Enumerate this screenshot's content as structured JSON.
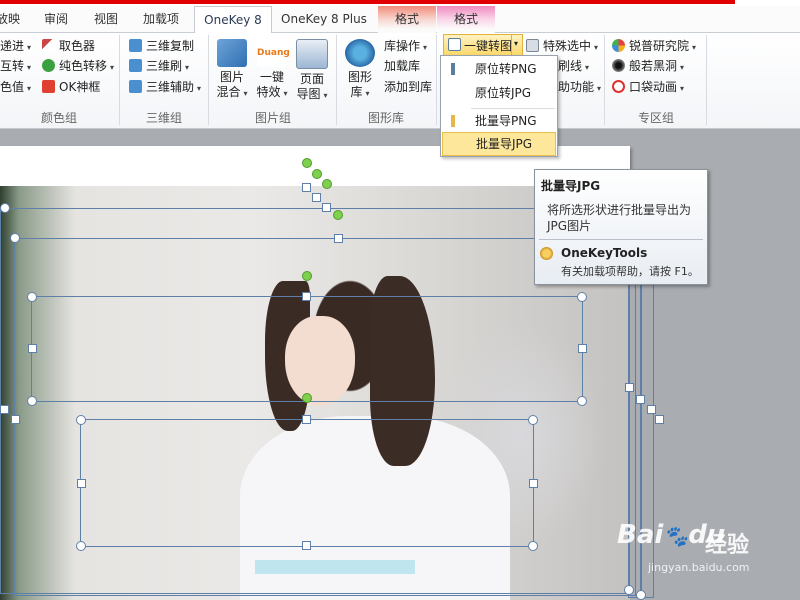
{
  "tabs": [
    "放映",
    "审阅",
    "视图",
    "加载项",
    "OneKey 8",
    "OneKey 8 Plus",
    "格式",
    "格式"
  ],
  "ribbon": {
    "color_group": {
      "items": [
        "递进",
        "取色器",
        "互转",
        "纯色转移",
        "色值",
        "OK神框"
      ],
      "label": "颜色组"
    },
    "threed_group": {
      "items": [
        "三维复制",
        "三维刷",
        "三维辅助"
      ],
      "label": "三维组"
    },
    "image_group": {
      "mix": [
        "图片",
        "混合"
      ],
      "effect": [
        "一键",
        "特效"
      ],
      "page": [
        "页面",
        "导图"
      ],
      "duang": "Duang",
      "label": "图片组"
    },
    "shape_group": {
      "lib": [
        "图形",
        "库"
      ],
      "items": [
        "库操作",
        "加载库",
        "添加到库"
      ],
      "label": "图形库"
    },
    "convert": {
      "split_label": "一键转图",
      "special": "特殊选中",
      "line": "刷线",
      "func": "助功能"
    },
    "zone_group": {
      "items": [
        "锐普研究院",
        "般若黑洞",
        "口袋动画"
      ],
      "label": "专区组"
    }
  },
  "menu": {
    "items": [
      "原位转PNG",
      "原位转JPG",
      "批量导PNG",
      "批量导JPG"
    ]
  },
  "tooltip": {
    "title": "批量导JPG",
    "desc": "将所选形状进行批量导出为JPG图片",
    "addin": "OneKeyTools",
    "help": "有关加载项帮助，请按 F1。"
  },
  "watermark": {
    "logo": "Bai",
    "logo2": "du",
    "site": "经验",
    "url": "jingyan.baidu.com"
  },
  "colors": {
    "red_strip": "#e00000",
    "menu_highlight": "#fde79a",
    "selection": "#5e7fa8",
    "rotate_handle": "#7ed04d"
  }
}
